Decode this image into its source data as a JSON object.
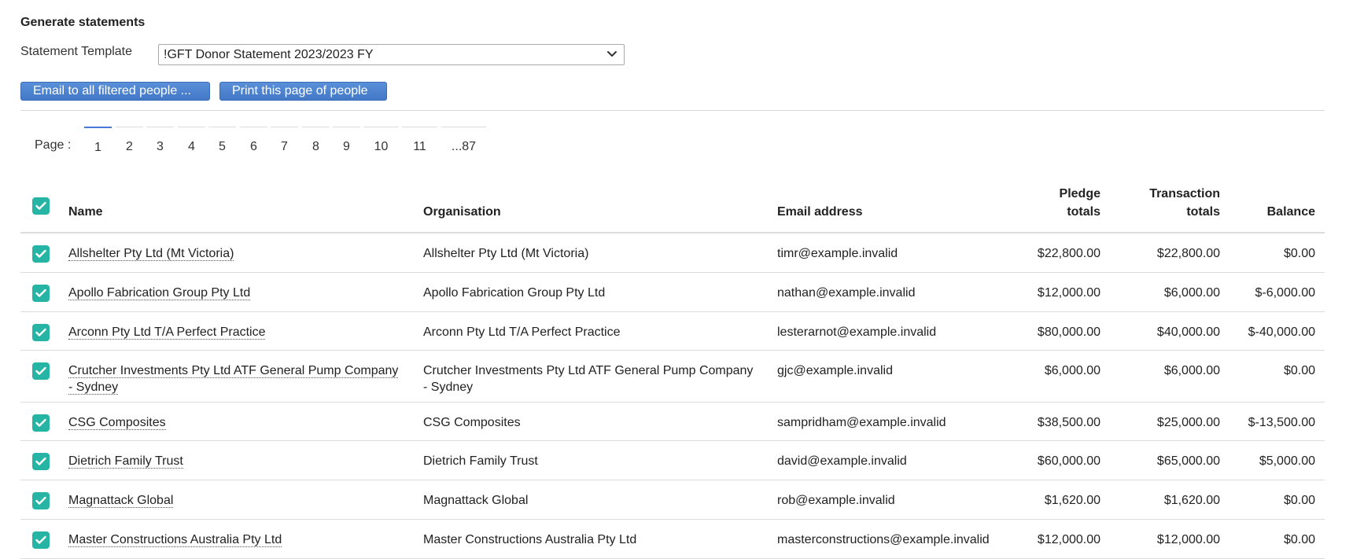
{
  "header": {
    "title": "Generate statements",
    "template_label": "Statement Template",
    "template_selected": "!GFT Donor Statement 2023/2023 FY",
    "email_button": "Email to all filtered people ...",
    "print_button": "Print this page of people"
  },
  "pager": {
    "label": "Page :",
    "pages": [
      "1",
      "2",
      "3",
      "4",
      "5",
      "6",
      "7",
      "8",
      "9",
      "10",
      "11",
      "...87"
    ],
    "active": "1"
  },
  "table": {
    "columns": {
      "name": "Name",
      "organisation": "Organisation",
      "email": "Email address",
      "pledge_l1": "Pledge",
      "pledge_l2": "totals",
      "transaction_l1": "Transaction",
      "transaction_l2": "totals",
      "balance": "Balance"
    },
    "rows": [
      {
        "name": "Allshelter Pty Ltd (Mt Victoria)",
        "organisation": "Allshelter Pty Ltd (Mt Victoria)",
        "email": "timr@example.invalid",
        "pledge": "$22,800.00",
        "transaction": "$22,800.00",
        "balance": "$0.00",
        "checked": true
      },
      {
        "name": "Apollo Fabrication Group Pty Ltd",
        "organisation": "Apollo Fabrication Group Pty Ltd",
        "email": "nathan@example.invalid",
        "pledge": "$12,000.00",
        "transaction": "$6,000.00",
        "balance": "$-6,000.00",
        "checked": true
      },
      {
        "name": "Arconn Pty Ltd T/A Perfect Practice",
        "organisation": "Arconn Pty Ltd T/A Perfect Practice",
        "email": "lesterarnot@example.invalid",
        "pledge": "$80,000.00",
        "transaction": "$40,000.00",
        "balance": "$-40,000.00",
        "checked": true
      },
      {
        "name": "Crutcher Investments Pty Ltd ATF General Pump Company - Sydney",
        "organisation": "Crutcher Investments Pty Ltd ATF General Pump Company - Sydney",
        "email": "gjc@example.invalid",
        "pledge": "$6,000.00",
        "transaction": "$6,000.00",
        "balance": "$0.00",
        "checked": true
      },
      {
        "name": "CSG Composites",
        "organisation": "CSG Composites",
        "email": "sampridham@example.invalid",
        "pledge": "$38,500.00",
        "transaction": "$25,000.00",
        "balance": "$-13,500.00",
        "checked": true
      },
      {
        "name": "Dietrich Family Trust",
        "organisation": "Dietrich Family Trust",
        "email": "david@example.invalid",
        "pledge": "$60,000.00",
        "transaction": "$65,000.00",
        "balance": "$5,000.00",
        "checked": true
      },
      {
        "name": "Magnattack Global",
        "organisation": "Magnattack Global",
        "email": "rob@example.invalid",
        "pledge": "$1,620.00",
        "transaction": "$1,620.00",
        "balance": "$0.00",
        "checked": true
      },
      {
        "name": "Master Constructions Australia Pty Ltd",
        "organisation": "Master Constructions Australia Pty Ltd",
        "email": "masterconstructions@example.invalid",
        "pledge": "$12,000.00",
        "transaction": "$12,000.00",
        "balance": "$0.00",
        "checked": true
      }
    ]
  },
  "colors": {
    "accent": "#4479c8",
    "checkbox": "#26b5a5"
  },
  "icons": {
    "select_chevron": "chevron-down-icon",
    "checkbox": "check-icon"
  }
}
